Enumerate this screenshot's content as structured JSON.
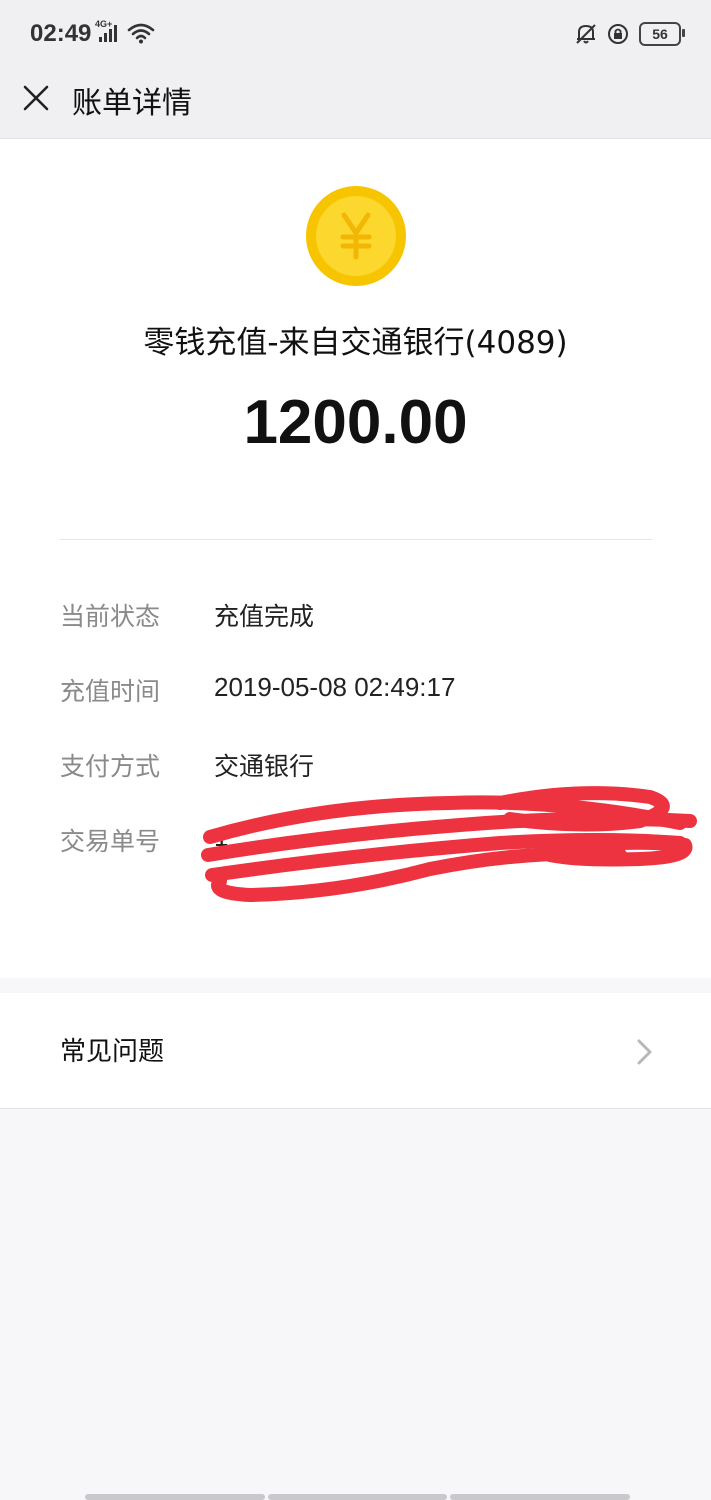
{
  "status_bar": {
    "time": "02:49",
    "network": "4G+",
    "battery_level": "56",
    "icons": [
      "signal-icon",
      "wifi-icon",
      "bell-off-icon",
      "rotation-lock-icon",
      "battery-icon"
    ]
  },
  "nav": {
    "title": "账单详情",
    "close_icon": "close-icon"
  },
  "transaction": {
    "icon": "yuan-coin-icon",
    "title": "零钱充值-来自交通银行(4089)",
    "amount": "1200.00"
  },
  "details": [
    {
      "key": "当前状态",
      "value": "充值完成"
    },
    {
      "key": "充值时间",
      "value": "2019-05-08 02:49:17"
    },
    {
      "key": "支付方式",
      "value": "交通银行"
    },
    {
      "key": "交易单号",
      "value": "1"
    }
  ],
  "faq": {
    "label": "常见问题",
    "icon": "chevron-right-icon"
  },
  "colors": {
    "coin_gold": "#f6c500",
    "coin_inner": "#fcd72e",
    "redaction_red": "#ee3340",
    "background": "#f7f6f8"
  }
}
